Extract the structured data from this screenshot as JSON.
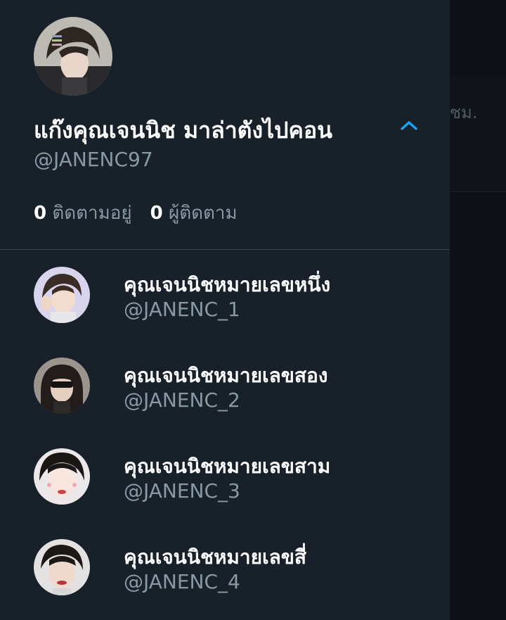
{
  "background": {
    "timestamp_fragment": "/ ชม.",
    "settings_icon": "gear-icon"
  },
  "drawer": {
    "display_name": "แก๊งคุณเจนนิช มาล่าตังไปคอน",
    "handle": "@JANENC97",
    "following_count": "0",
    "following_label": "ติดตามอยู่",
    "followers_count": "0",
    "followers_label": "ผู้ติดตาม",
    "toggle_icon": "chevron-up-icon",
    "accent_color": "#1da1f2",
    "accounts": [
      {
        "name": "คุณเจนนิชหมายเลขหนึ่ง",
        "handle": "@JANENC_1"
      },
      {
        "name": "คุณเจนนิชหมายเลขสอง",
        "handle": "@JANENC_2"
      },
      {
        "name": "คุณเจนนิชหมายเลขสาม",
        "handle": "@JANENC_3"
      },
      {
        "name": "คุณเจนนิชหมายเลขสี่",
        "handle": "@JANENC_4"
      }
    ]
  }
}
